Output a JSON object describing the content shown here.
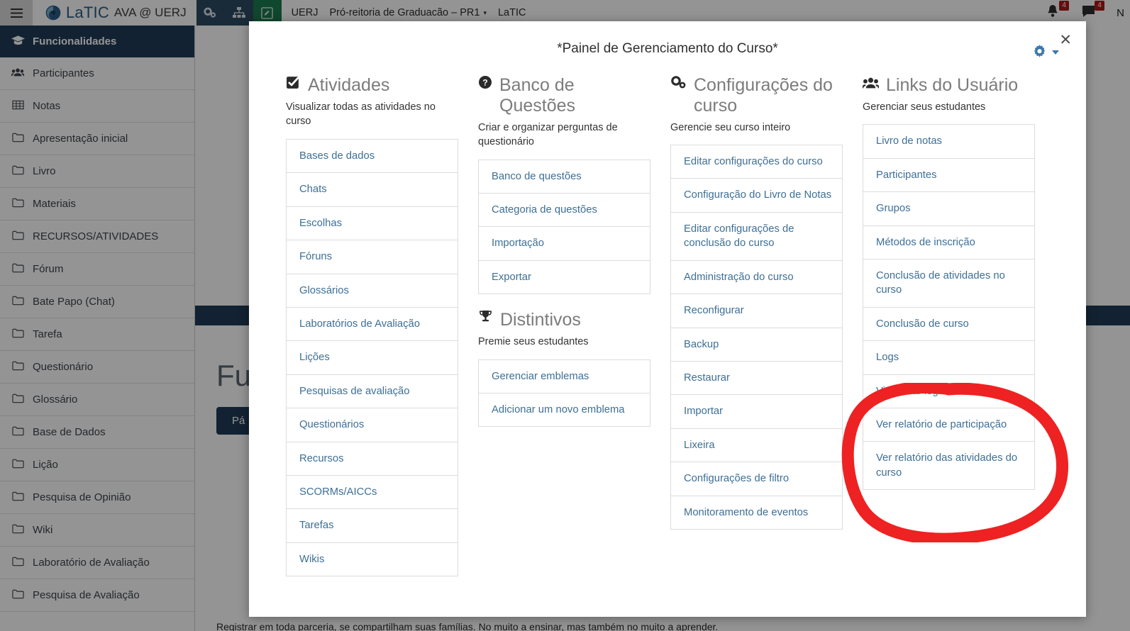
{
  "navbar": {
    "menu_icon": "hamburger-icon",
    "brand": "LaTIC",
    "brand_sub": "AVA @ UERJ",
    "icons": [
      "cogs-icon",
      "sitemap-icon",
      "edit-square-icon"
    ],
    "breadcrumbs": [
      "UERJ",
      "Pró-reitoria de Graduacão – PR1",
      "LaTIC"
    ],
    "caret": "▾",
    "notifications": [
      {
        "icon": "bell-icon",
        "count": "4"
      },
      {
        "icon": "message-icon",
        "count": "4"
      }
    ],
    "user": "N"
  },
  "sidebar": {
    "header": {
      "icon": "graduation-cap-icon",
      "label": "Funcionalidades"
    },
    "items": [
      {
        "icon": "users-icon",
        "label": "Participantes"
      },
      {
        "icon": "table-icon",
        "label": "Notas"
      },
      {
        "icon": "folder-icon",
        "label": "Apresentação inicial"
      },
      {
        "icon": "folder-icon",
        "label": "Livro"
      },
      {
        "icon": "folder-icon",
        "label": "Materiais"
      },
      {
        "icon": "folder-icon",
        "label": "RECURSOS/ATIVIDADES"
      },
      {
        "icon": "folder-icon",
        "label": "Fórum"
      },
      {
        "icon": "folder-icon",
        "label": "Bate Papo (Chat)"
      },
      {
        "icon": "folder-icon",
        "label": "Tarefa"
      },
      {
        "icon": "folder-icon",
        "label": "Questionário"
      },
      {
        "icon": "folder-icon",
        "label": "Glossário"
      },
      {
        "icon": "folder-icon",
        "label": "Base de Dados"
      },
      {
        "icon": "folder-icon",
        "label": "Lição"
      },
      {
        "icon": "folder-icon",
        "label": "Pesquisa de Opinião"
      },
      {
        "icon": "folder-icon",
        "label": "Wiki"
      },
      {
        "icon": "folder-icon",
        "label": "Laboratório de Avaliação"
      },
      {
        "icon": "folder-icon",
        "label": "Pesquisa de Avaliação"
      }
    ]
  },
  "background_page": {
    "title": "Fu",
    "button": "Pá",
    "footer": "Registrar em toda parceria, se compartilham suas famílias. No muito a ensinar, mas também no muito a aprender."
  },
  "modal": {
    "title": "*Painel de Gerenciamento do Curso*",
    "close_icon": "close-icon",
    "gear_icon": "gear-icon",
    "sections": [
      {
        "icon": "check-square-icon",
        "title": "Atividades",
        "desc": "Visualizar todas as atividades no curso",
        "items": [
          "Bases de dados",
          "Chats",
          "Escolhas",
          "Fóruns",
          "Glossários",
          "Laboratórios de Avaliação",
          "Lições",
          "Pesquisas de avaliação",
          "Questionários",
          "Recursos",
          "SCORMs/AICCs",
          "Tarefas",
          "Wikis"
        ]
      },
      {
        "icon": "question-circle-icon",
        "title": "Banco de Questões",
        "desc": "Criar e organizar perguntas de questionário",
        "items": [
          "Banco de questões",
          "Categoria de questões",
          "Importação",
          "Exportar"
        ]
      },
      {
        "icon": "trophy-icon",
        "title": "Distintivos",
        "desc": "Premie seus estudantes",
        "items": [
          "Gerenciar emblemas",
          "Adicionar um novo emblema"
        ]
      },
      {
        "icon": "cogs-icon",
        "title": "Configurações do curso",
        "desc": "Gerencie seu curso inteiro",
        "items": [
          "Editar configurações do curso",
          "Configuração do Livro de Notas",
          "Editar configurações de conclusão do curso",
          "Administração do curso",
          "Reconfigurar",
          "Backup",
          "Restaurar",
          "Importar",
          "Lixeira",
          "Configurações de filtro",
          "Monitoramento de eventos"
        ]
      },
      {
        "icon": "users-icon",
        "title": "Links do Usuário",
        "desc": "Gerenciar seus estudantes",
        "items": [
          "Livro de notas",
          "Participantes",
          "Grupos",
          "Métodos de inscrição",
          "Conclusão de atividades no curso",
          "Conclusão de curso",
          "Logs",
          "Visualizar logs ativos",
          "Ver relatório de participação",
          "Ver relatório das atividades do curso"
        ]
      }
    ]
  },
  "annotation": {
    "shape": "hand-drawn-ellipse",
    "color": "#ee2222",
    "targets": [
      "Visualizar logs ativos",
      "Ver relatório de participação",
      "Ver relatório das atividades do curso"
    ]
  },
  "colors": {
    "navy": "#1f3c56",
    "link_blue": "#3d6f96",
    "accent_gear": "#3d77a8",
    "badge_red": "#b01717",
    "annotation_red": "#ee2222",
    "green_button": "#1d7a51"
  }
}
